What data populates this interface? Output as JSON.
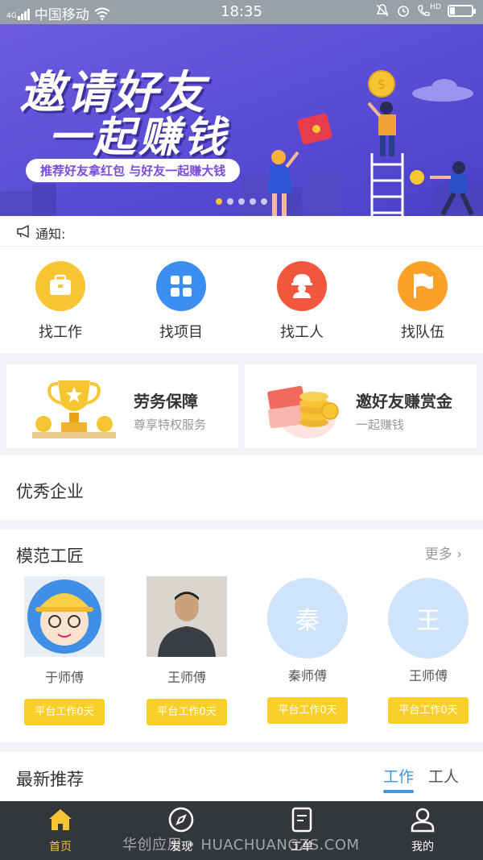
{
  "status_bar": {
    "carrier": "中国移动",
    "signal_label": "4G",
    "time": "18:35",
    "hd_label": "HD"
  },
  "banner": {
    "title_line1": "邀请好友",
    "title_line2": "一起赚钱",
    "subtitle": "推荐好友拿红包 与好友一起赚大钱",
    "slide_count": 5,
    "active_slide": 1
  },
  "notice": {
    "label": "通知:"
  },
  "quick_menu": [
    {
      "label": "找工作",
      "icon": "briefcase-icon",
      "color": "#f7c531"
    },
    {
      "label": "找项目",
      "icon": "grid-icon",
      "color": "#3c8ff1"
    },
    {
      "label": "找工人",
      "icon": "worker-icon",
      "color": "#f2573e"
    },
    {
      "label": "找队伍",
      "icon": "flag-icon",
      "color": "#f9a227"
    }
  ],
  "promos": [
    {
      "title": "劳务保障",
      "subtitle": "尊享特权服务",
      "icon": "trophy-icon"
    },
    {
      "title": "邀好友赚赏金",
      "subtitle": "一起赚钱",
      "icon": "coins-icon"
    }
  ],
  "excellent_companies": {
    "title": "优秀企业"
  },
  "model_workers": {
    "title": "模范工匠",
    "more_label": "更多",
    "workers": [
      {
        "name": "于师傅",
        "badge": "平台工作0天",
        "avatar": "cartoon-avatar"
      },
      {
        "name": "王师傅",
        "badge": "平台工作0天",
        "avatar": "photo-avatar"
      },
      {
        "name": "秦师傅",
        "badge": "平台工作0天",
        "avatar_text": "秦"
      },
      {
        "name": "王师傅",
        "badge": "平台工作0天",
        "avatar_text": "王"
      }
    ]
  },
  "latest": {
    "title": "最新推荐",
    "tabs": [
      "工作",
      "工人"
    ],
    "active_tab": 0
  },
  "bottom_nav": [
    {
      "label": "首页",
      "icon": "home-icon",
      "active": true
    },
    {
      "label": "发现",
      "icon": "compass-icon",
      "active": false
    },
    {
      "label": "工单",
      "icon": "document-icon",
      "active": false
    },
    {
      "label": "我的",
      "icon": "user-icon",
      "active": false
    }
  ],
  "watermark": "华创应用 • HUACHUANGZS.COM",
  "colors": {
    "accent_yellow": "#f7c531",
    "tab_blue": "#3d95e8",
    "banner_purple": "#5d4fd6",
    "nav_dark": "#33363b"
  }
}
